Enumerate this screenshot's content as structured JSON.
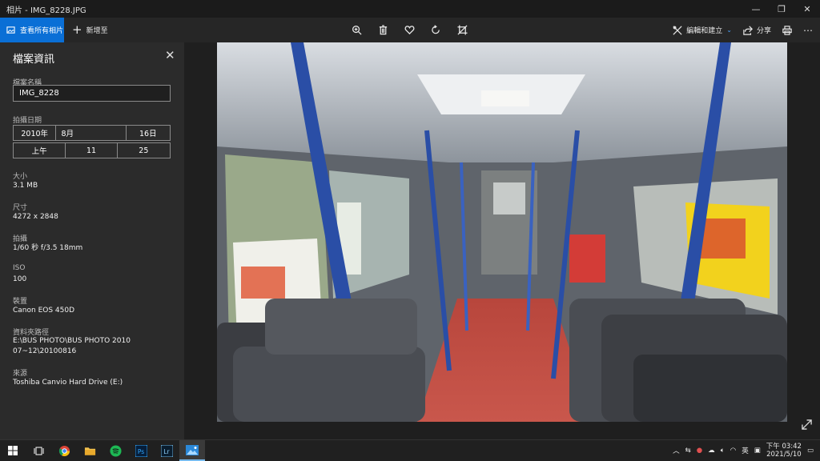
{
  "window": {
    "title": "相片 - IMG_8228.JPG"
  },
  "toolbar": {
    "view_all_label": "查看所有相片",
    "add_to_label": "新增至",
    "edit_create_label": "編輯和建立",
    "share_label": "分享"
  },
  "info_panel": {
    "title": "檔案資訊",
    "file_name_label": "檔案名稱",
    "file_name_value": "IMG_8228",
    "date_label": "拍攝日期",
    "date": {
      "year": "2010年",
      "month": "8月",
      "day": "16日"
    },
    "time": {
      "ampm": "上午",
      "hour": "11",
      "minute": "25"
    },
    "size_label": "大小",
    "size_value": "3.1 MB",
    "dimensions_label": "尺寸",
    "dimensions_value": "4272 x 2848",
    "shot_label": "拍攝",
    "shot_value": "1/60 秒 f/3.5 18mm",
    "iso_label": "ISO",
    "iso_value": "100",
    "device_label": "裝置",
    "device_value": "Canon EOS 450D",
    "folder_label": "資料夾路徑",
    "folder_value_line1": "E:\\BUS PHOTO\\BUS PHOTO 2010",
    "folder_value_line2": "07~12\\20100816",
    "source_label": "來源",
    "source_value": "Toshiba Canvio Hard Drive (E:)"
  },
  "taskbar": {
    "tray_ime": "英",
    "clock_time": "下午 03:42",
    "clock_date": "2021/5/10"
  },
  "colors": {
    "accent": "#0a6fd6",
    "panel_bg": "#2b2b2b",
    "app_bg": "#1f1f1f"
  }
}
